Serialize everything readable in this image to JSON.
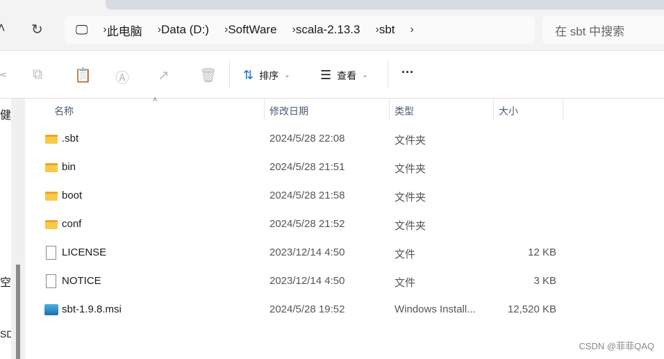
{
  "nav": {
    "refresh_icon": "refresh-icon"
  },
  "address": {
    "segments": [
      "此电脑",
      "Data (D:)",
      "SoftWare",
      "scala-2.13.3",
      "sbt"
    ]
  },
  "search": {
    "placeholder": "在 sbt 中搜索"
  },
  "toolbar": {
    "sort_label": "排序",
    "view_label": "查看",
    "more_label": "···"
  },
  "sidebar": {
    "items": [
      "健",
      "空",
      "SD"
    ]
  },
  "columns": {
    "name": "名称",
    "modified": "修改日期",
    "type": "类型",
    "size": "大小"
  },
  "files": [
    {
      "name": ".sbt",
      "modified": "2024/5/28 22:08",
      "type": "文件夹",
      "size": "",
      "icon": "folder"
    },
    {
      "name": "bin",
      "modified": "2024/5/28 21:51",
      "type": "文件夹",
      "size": "",
      "icon": "folder"
    },
    {
      "name": "boot",
      "modified": "2024/5/28 21:58",
      "type": "文件夹",
      "size": "",
      "icon": "folder"
    },
    {
      "name": "conf",
      "modified": "2024/5/28 21:52",
      "type": "文件夹",
      "size": "",
      "icon": "folder"
    },
    {
      "name": "LICENSE",
      "modified": "2023/12/14 4:50",
      "type": "文件",
      "size": "12 KB",
      "icon": "file"
    },
    {
      "name": "NOTICE",
      "modified": "2023/12/14 4:50",
      "type": "文件",
      "size": "3 KB",
      "icon": "file"
    },
    {
      "name": "sbt-1.9.8.msi",
      "modified": "2024/5/28 19:52",
      "type": "Windows Install...",
      "size": "12,520 KB",
      "icon": "msi"
    }
  ],
  "watermark": "CSDN @菲菲QAQ"
}
